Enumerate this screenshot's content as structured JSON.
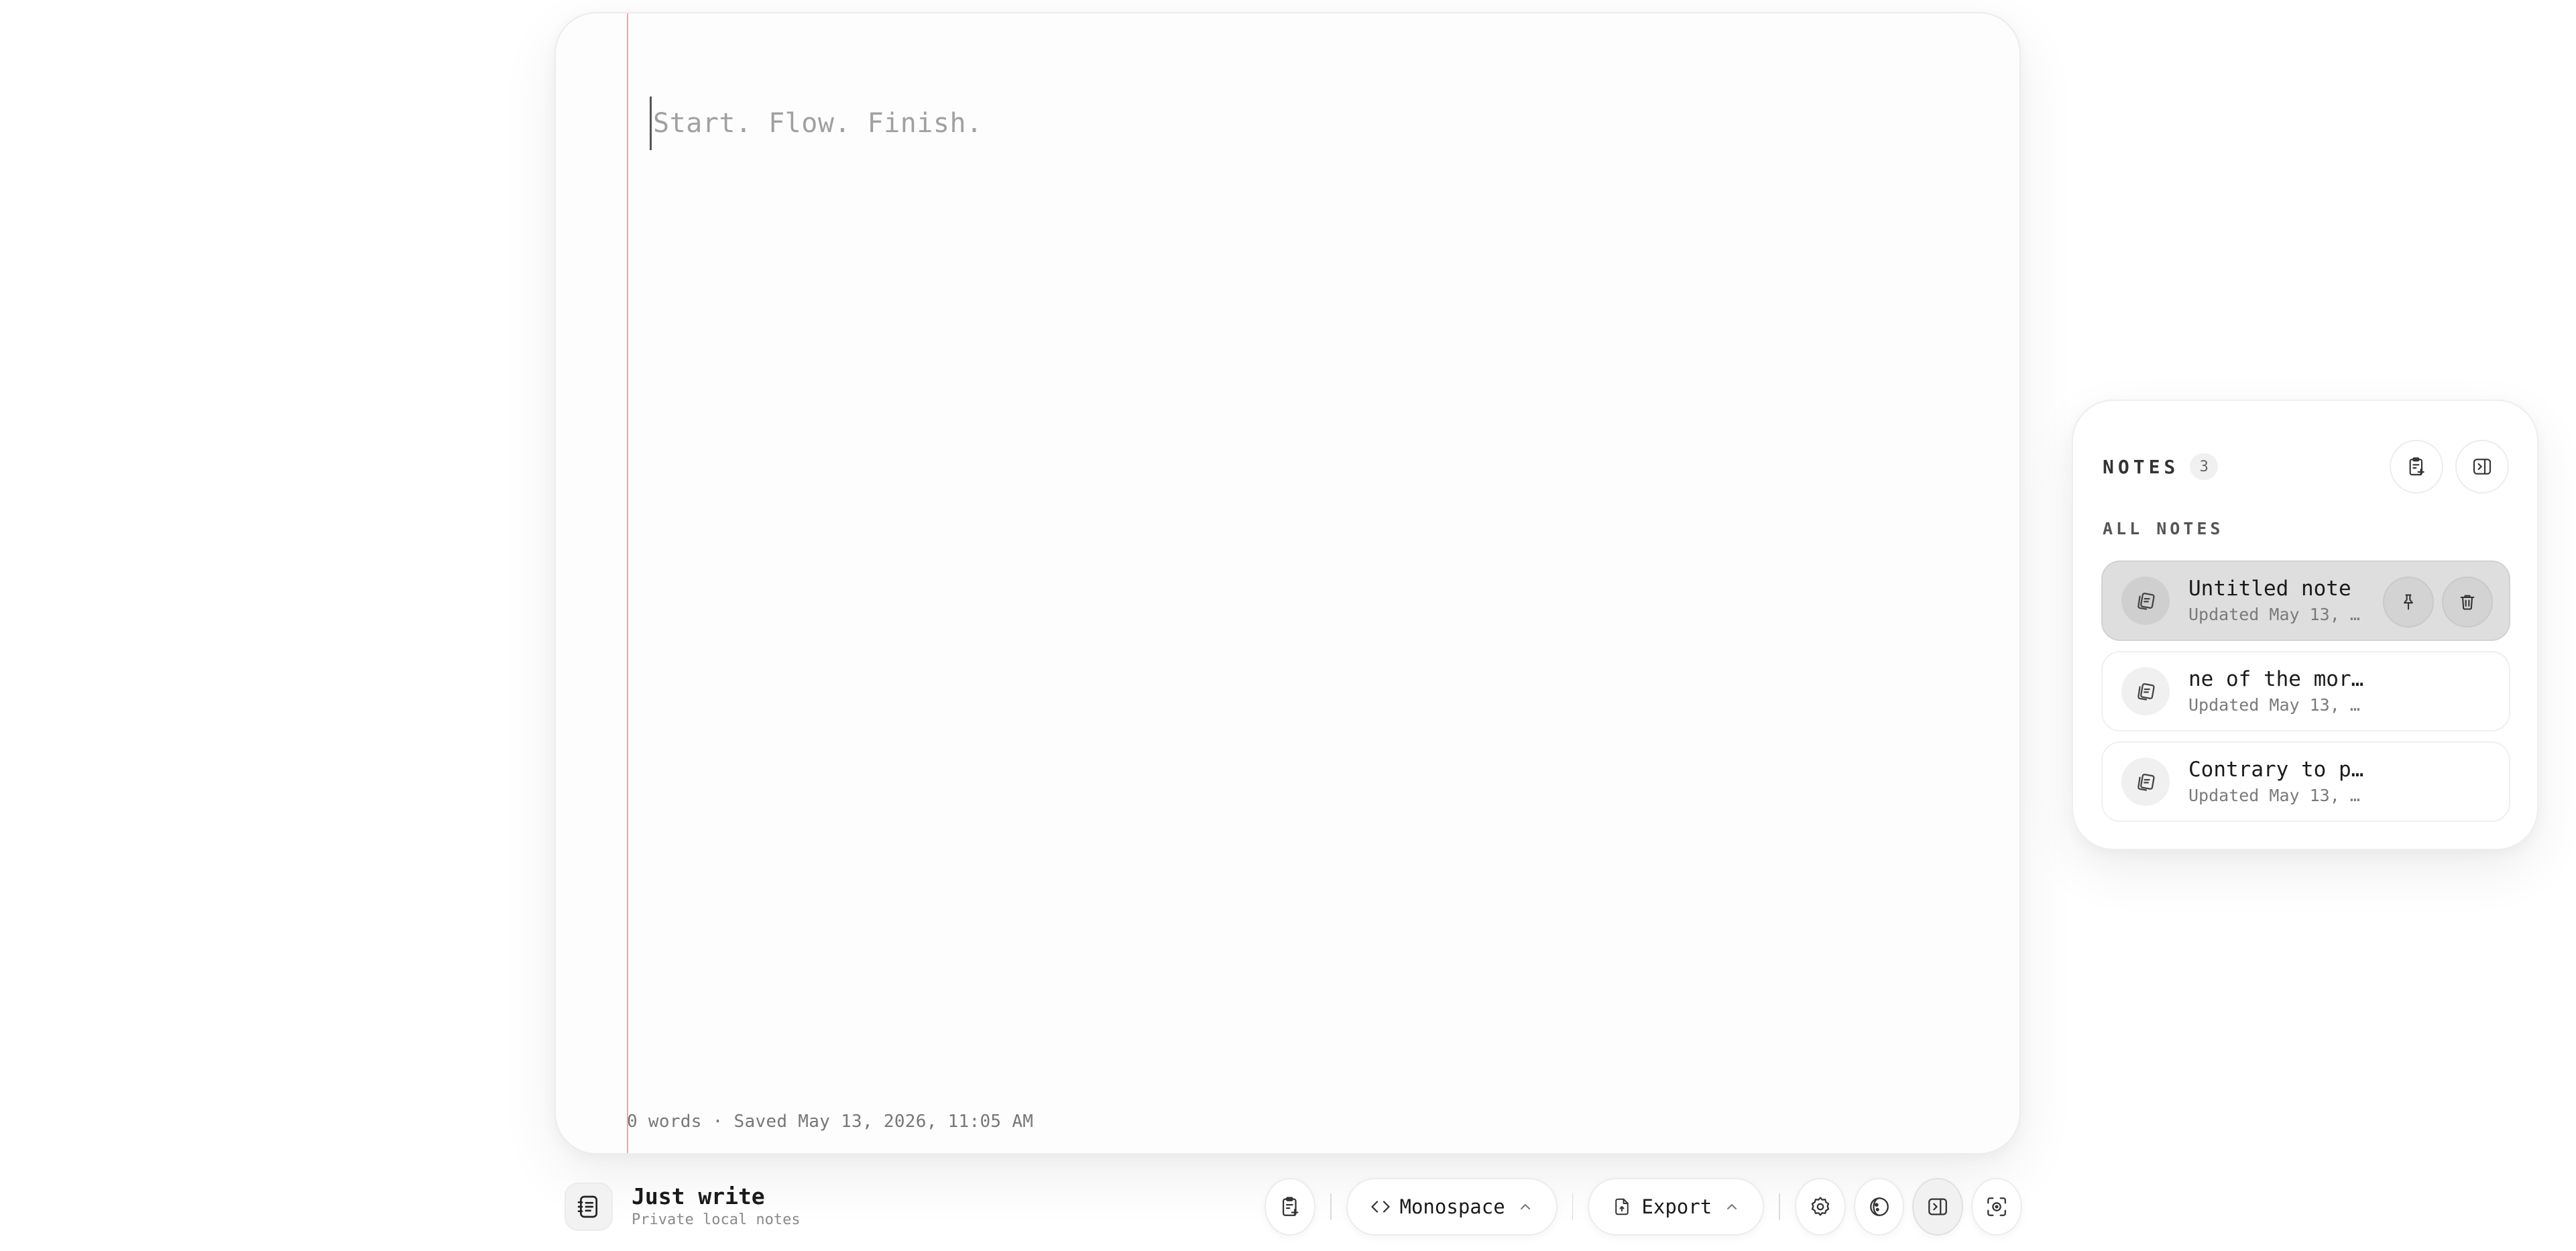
{
  "app": {
    "name": "Just write",
    "tagline": "Private local notes"
  },
  "editor": {
    "placeholder": "Start. Flow. Finish.",
    "status": "0 words · Saved May 13, 2026, 11:05 AM"
  },
  "toolbar": {
    "new_note_icon": "new-note-icon",
    "font_label": "Monospace",
    "export_label": "Export",
    "icons": [
      "settings-icon",
      "theme-icon",
      "sidebar-toggle-icon",
      "focus-icon"
    ]
  },
  "notes_panel": {
    "title": "NOTES",
    "count": "3",
    "section_label": "ALL NOTES",
    "notes": [
      {
        "title": "Untitled note",
        "meta": "Updated May 13, …",
        "selected": true
      },
      {
        "title": "ne of the mor…",
        "meta": "Updated May 13, …",
        "selected": false
      },
      {
        "title": "Contrary to p…",
        "meta": "Updated May 13, …",
        "selected": false
      }
    ]
  },
  "colors": {
    "margin_line": "#f1a9a0",
    "rule_line": "#e3e3e3",
    "selected_note": "#dedede"
  }
}
